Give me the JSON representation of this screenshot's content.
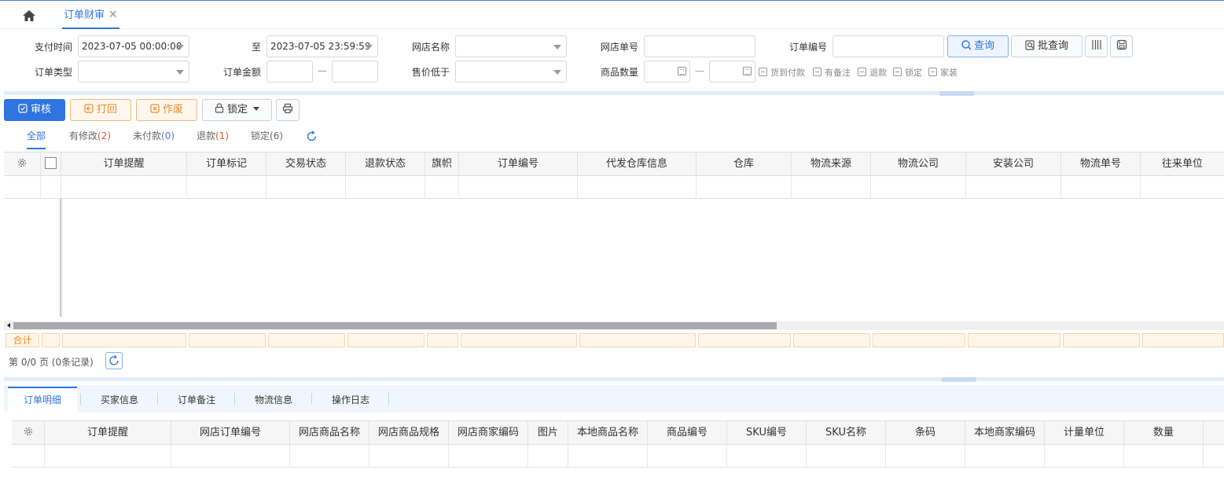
{
  "header": {
    "home_icon": "home-icon",
    "tab_label": "订单财审",
    "tab_close": "✕"
  },
  "filters": {
    "pay_time_label": "支付时间",
    "pay_time_from": "2023-07-05 00:00:00",
    "to_label": "至",
    "pay_time_to": "2023-07-05 23:59:59",
    "shop_name_label": "网店名称",
    "shop_order_no_label": "网店单号",
    "order_no_label": "订单编号",
    "order_type_label": "订单类型",
    "order_amount_label": "订单金额",
    "price_below_label": "售价低于",
    "qty_label": "商品数量",
    "range_sep": "—",
    "search_button": "查询",
    "batch_search_button": "批查询",
    "checkboxes": [
      "货到付款",
      "有备注",
      "退款",
      "锁定",
      "家装"
    ]
  },
  "toolbar": {
    "audit": "审核",
    "reject": "打回",
    "void": "作废",
    "lock": "锁定"
  },
  "status_tabs": [
    {
      "label": "全部",
      "count": ""
    },
    {
      "label": "有修改",
      "count": "(2)"
    },
    {
      "label": "未付款",
      "count": "(0)"
    },
    {
      "label": "退款",
      "count": "(1)"
    },
    {
      "label": "锁定",
      "count": "(6)"
    }
  ],
  "main_columns": [
    "订单提醒",
    "订单标记",
    "交易状态",
    "退款状态",
    "旗帜",
    "订单编号",
    "代发仓库信息",
    "仓库",
    "物流来源",
    "物流公司",
    "安装公司",
    "物流单号",
    "往来单位"
  ],
  "summary": {
    "label": "合计"
  },
  "pager": {
    "text": "第 0/0 页 (0条记录)"
  },
  "bottom_tabs": [
    "订单明细",
    "买家信息",
    "订单备注",
    "物流信息",
    "操作日志"
  ],
  "detail_columns": [
    "订单提醒",
    "网店订单编号",
    "网店商品名称",
    "网店商品规格",
    "网店商家编码",
    "图片",
    "本地商品名称",
    "商品编号",
    "SKU编号",
    "SKU名称",
    "条码",
    "本地商家编码",
    "计量单位",
    "数量"
  ],
  "colors": {
    "accent": "#2f74e0",
    "warning": "#f08a24",
    "count_red": "#e0553b",
    "count_blue": "#6a6fd6"
  }
}
